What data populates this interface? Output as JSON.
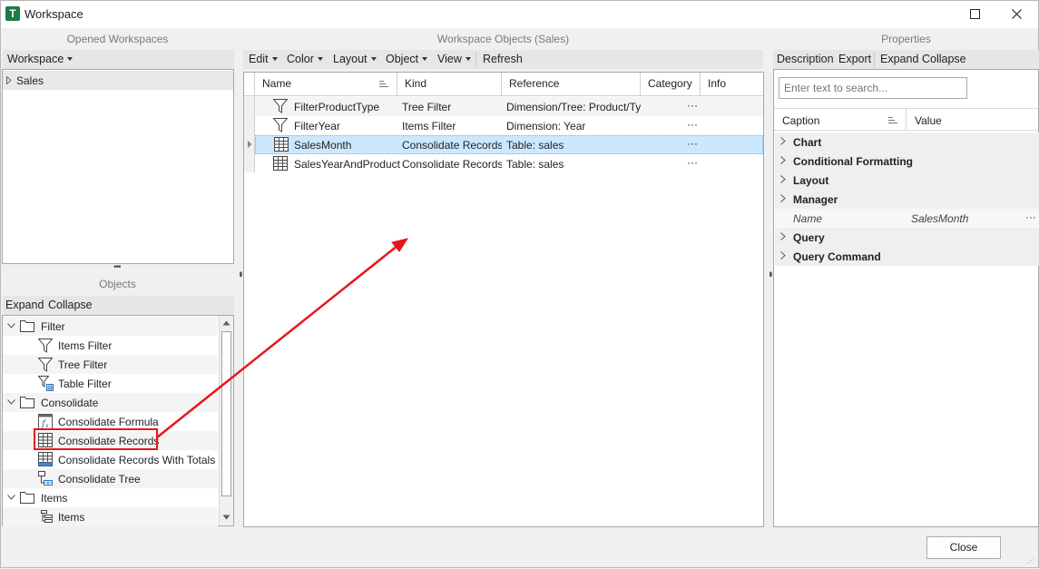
{
  "window": {
    "title": "Workspace",
    "app_icon_letter": "T"
  },
  "captions": {
    "opened_workspaces": "Opened Workspaces",
    "workspace_objects": "Workspace Objects (Sales)",
    "properties": "Properties",
    "objects": "Objects"
  },
  "workspace_panel": {
    "dropdown_label": "Workspace",
    "items": [
      {
        "label": "Sales"
      }
    ]
  },
  "objects_panel": {
    "toolbar": {
      "expand": "Expand",
      "collapse": "Collapse"
    },
    "groups": [
      {
        "label": "Filter",
        "items": [
          "Items Filter",
          "Tree Filter",
          "Table Filter"
        ]
      },
      {
        "label": "Consolidate",
        "items": [
          "Consolidate Formula",
          "Consolidate Records",
          "Consolidate Records With Totals",
          "Consolidate Tree"
        ]
      },
      {
        "label": "Items",
        "items": [
          "Items"
        ]
      }
    ],
    "highlighted_item": "Consolidate Records"
  },
  "objects_toolbar": {
    "edit": "Edit",
    "color": "Color",
    "layout": "Layout",
    "object": "Object",
    "view": "View",
    "refresh": "Refresh"
  },
  "objects_grid": {
    "columns": [
      "Name",
      "Kind",
      "Reference",
      "Category",
      "Info"
    ],
    "rows": [
      {
        "name": "FilterProductType",
        "kind": "Tree Filter",
        "reference": "Dimension/Tree: Product/Typ",
        "info": "···"
      },
      {
        "name": "FilterYear",
        "kind": "Items Filter",
        "reference": "Dimension: Year",
        "info": "···"
      },
      {
        "name": "SalesMonth",
        "kind": "Consolidate Records",
        "reference": "Table: sales",
        "info": "···"
      },
      {
        "name": "SalesYearAndProduct",
        "kind": "Consolidate Records",
        "reference": "Table: sales",
        "info": "···"
      }
    ],
    "selected_row": 2
  },
  "properties": {
    "toolbar": {
      "description": "Description",
      "export": "Export",
      "expand": "Expand",
      "collapse": "Collapse"
    },
    "search_placeholder": "Enter text to search...",
    "columns": {
      "caption": "Caption",
      "value": "Value"
    },
    "categories": [
      "Chart",
      "Conditional Formatting",
      "Layout",
      "Manager",
      "Query",
      "Query Command"
    ],
    "name_property": {
      "label": "Name",
      "value": "SalesMonth",
      "ellipsis": "···"
    }
  },
  "footer": {
    "close": "Close"
  },
  "colors": {
    "accent_green": "#1e7b45",
    "selection_blue": "#cce8ff",
    "arrow_red": "#e8161b"
  }
}
